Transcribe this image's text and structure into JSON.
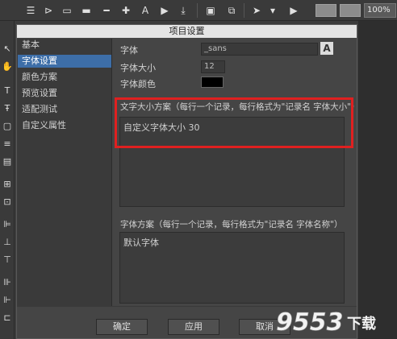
{
  "toolbar": {
    "zoom": "100%",
    "icons": [
      "list-icon",
      "tag-icon",
      "rectangle-icon",
      "button-icon",
      "minus-icon",
      "plus-icon",
      "text-icon",
      "media-icon",
      "import-icon",
      "save-icon",
      "save-all-icon",
      "publish-icon",
      "dropdown-icon",
      "play-icon"
    ]
  },
  "dialog": {
    "title": "项目设置",
    "nav": [
      "基本",
      "字体设置",
      "颜色方案",
      "预览设置",
      "适配测试",
      "自定义属性"
    ],
    "active_nav_index": 1,
    "font_label": "字体",
    "font_value": "_sans",
    "font_button": "A",
    "font_size_label": "字体大小",
    "font_size_value": "12",
    "font_color_label": "字体颜色",
    "font_color_value": "#000000",
    "size_scheme_label": "文字大小方案（每行一个记录，每行格式为\"记录名 字体大小\"）",
    "size_scheme_text": "自定义字体大小 30",
    "font_scheme_label": "字体方案（每行一个记录，每行格式为\"记录名 字体名称\"）",
    "font_scheme_text": "默认字体",
    "buttons": {
      "ok": "确定",
      "apply": "应用",
      "cancel": "取消"
    }
  },
  "watermark": {
    "text": "9553下载"
  }
}
